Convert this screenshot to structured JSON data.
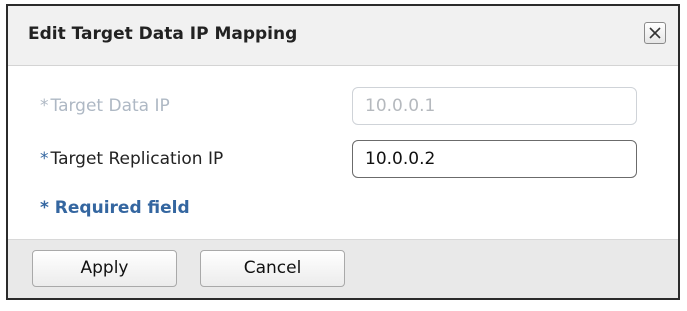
{
  "dialog": {
    "title": "Edit Target Data IP Mapping",
    "close_icon": "close-icon"
  },
  "fields": [
    {
      "required_marker": "*",
      "label": "Target Data IP",
      "value": "10.0.0.1",
      "enabled": false
    },
    {
      "required_marker": "*",
      "label": "Target Replication IP",
      "value": "10.0.0.2",
      "enabled": true
    }
  ],
  "required_note": "* Required field",
  "buttons": {
    "apply": "Apply",
    "cancel": "Cancel"
  },
  "colors": {
    "accent": "#3466a0",
    "disabled_text": "#aeb8c4",
    "footer_bg": "#e9e9e9",
    "titlebar_bg": "#f1f1f1"
  }
}
